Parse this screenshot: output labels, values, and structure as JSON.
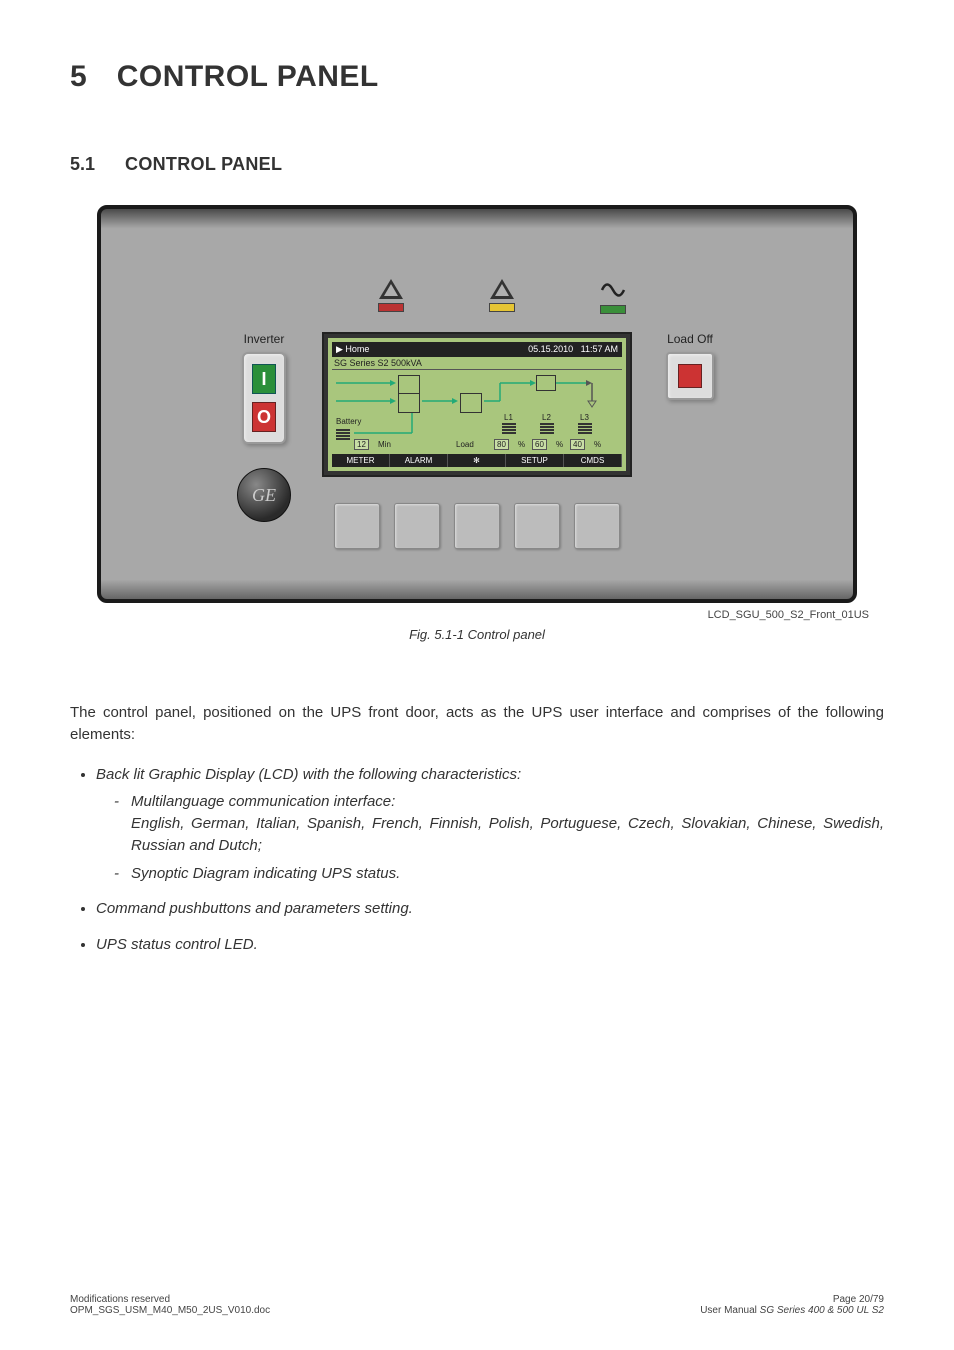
{
  "heading": {
    "num": "5",
    "title": "CONTROL PANEL"
  },
  "subheading": {
    "num": "5.1",
    "title": "CONTROL PANEL"
  },
  "panel": {
    "inverter_label": "Inverter",
    "loadoff_label": "Load Off",
    "io_i": "I",
    "io_o": "O",
    "ge_logo": "GE",
    "lcd": {
      "home": "▶ Home",
      "date": "05.15.2010",
      "time": "11:57 AM",
      "model": "SG Series S2 500kVA",
      "battery": "Battery",
      "min_value": "12",
      "min_unit": "Min",
      "load": "Load",
      "l1": "L1",
      "l2": "L2",
      "l3": "L3",
      "p1": "80",
      "p2": "60",
      "p3": "40",
      "pct": "%",
      "tabs": [
        "METER",
        "ALARM",
        "✻",
        "SETUP",
        "CMDS"
      ]
    }
  },
  "img_tag": "LCD_SGU_500_S2_Front_01US",
  "caption": "Fig. 5.1-1   Control panel",
  "para": "The control panel, positioned on the UPS front door, acts as the UPS user interface and comprises of the following elements:",
  "bullets": {
    "b1": "Back lit Graphic Display (LCD) with the following characteristics:",
    "b1a": "Multilanguage communication interface:",
    "b1a2": "English, German, Italian, Spanish, French, Finnish, Polish, Portuguese, Czech, Slovakian, Chinese, Swedish, Russian and Dutch;",
    "b1b": "Synoptic Diagram indicating UPS status.",
    "b2": "Command pushbuttons and parameters setting.",
    "b3": "UPS status control LED."
  },
  "footer": {
    "left1": "Modifications reserved",
    "left2": "OPM_SGS_USM_M40_M50_2US_V010.doc",
    "right1": "Page 20/79",
    "right2a": "User Manual ",
    "right2b": "SG Series 400 & 500 UL S2"
  }
}
